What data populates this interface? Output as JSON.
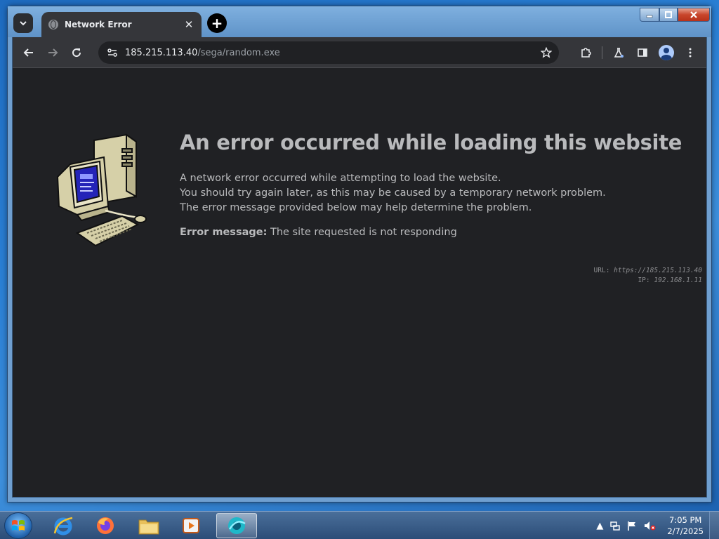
{
  "browser": {
    "tab_title": "Network Error",
    "new_tab_symbol": "+",
    "close_symbol": "✕",
    "window_controls": {
      "minimize": "▁",
      "maximize": "❐",
      "close": "✕"
    }
  },
  "address_bar": {
    "host": "185.215.113.40",
    "path": "/sega/random.exe"
  },
  "page": {
    "title": "An error occurred while loading this website",
    "body_lines": [
      "A network error occurred while attempting to load the website.",
      "You should try again later, as this may be caused by a temporary network problem.",
      "The error message provided below may help determine the problem."
    ],
    "error_label": "Error message:",
    "error_text": "The site requested is not responding",
    "meta_url_label": "URL:",
    "meta_url_value": "https://185.215.113.40",
    "meta_ip_label": "IP:",
    "meta_ip_value": "192.168.1.11"
  },
  "taskbar": {
    "time": "7:05 PM",
    "date": "2/7/2025",
    "apps": [
      "internet-explorer",
      "firefox",
      "file-explorer",
      "media-player",
      "browser-active"
    ]
  },
  "colors": {
    "page_bg": "#202124",
    "text": "#b9babc",
    "toolbar": "#35363a",
    "taskbar": "#2c4d78"
  }
}
